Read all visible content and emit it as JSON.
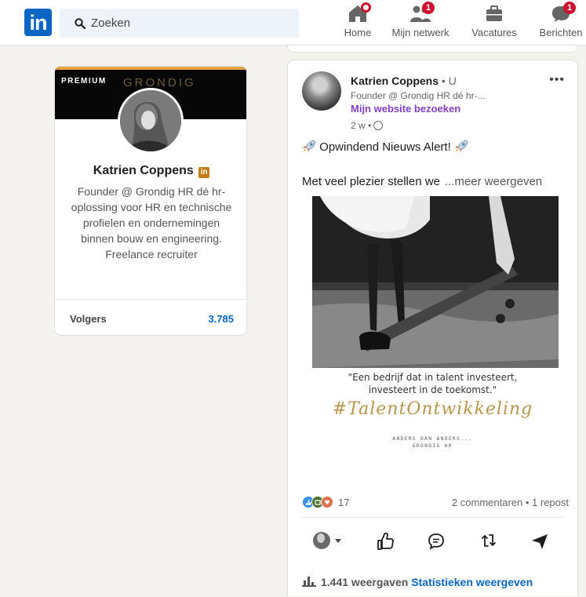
{
  "nav": {
    "logo": "in",
    "search_placeholder": "Zoeken",
    "items": [
      {
        "label": "Home",
        "badge": ""
      },
      {
        "label": "Mijn netwerk",
        "badge": "1"
      },
      {
        "label": "Vacatures",
        "badge": ""
      },
      {
        "label": "Berichten",
        "badge": "1"
      }
    ]
  },
  "profile": {
    "premium": "PREMIUM",
    "banner_brand": "GRONDIG",
    "name": "Katrien Coppens",
    "badge": "in",
    "headline": "Founder @ Grondig HR dé hr-oplossing voor HR en technische profielen en ondernemingen binnen bouw en engineering. Freelance recruiter",
    "followers_label": "Volgers",
    "followers_count": "3.785"
  },
  "post": {
    "author": "Katrien Coppens",
    "degree": " • U",
    "subtitle": "Founder @ Grondig HR dé hr-...",
    "website": "Mijn website bezoeken",
    "time": "2 w •",
    "more": "•••",
    "line1": "Opwindend Nieuws Alert!",
    "line2": "Met veel plezier stellen we",
    "see_more": "...meer weergeven",
    "image": {
      "quote_line1": "\"Een bedrijf dat in talent investeert,",
      "quote_line2": "investeert in de toekomst.\"",
      "hashtag": "#TalentOntwikkeling",
      "tagline1": "ANDERS DAN ANDERS...",
      "tagline2": "GRONDIG HR"
    },
    "reaction_count": "17",
    "comments": "2 commentaren • 1 repost",
    "views": "1.441 weergaven",
    "stats_link": "Statistieken weergeven"
  },
  "colors": {
    "brand": "#0a66c2",
    "premium_accent": "#e7a33e",
    "website_link": "#7f3fbf",
    "badge": "#cb112d",
    "hashtag_gold": "#b8964d"
  }
}
